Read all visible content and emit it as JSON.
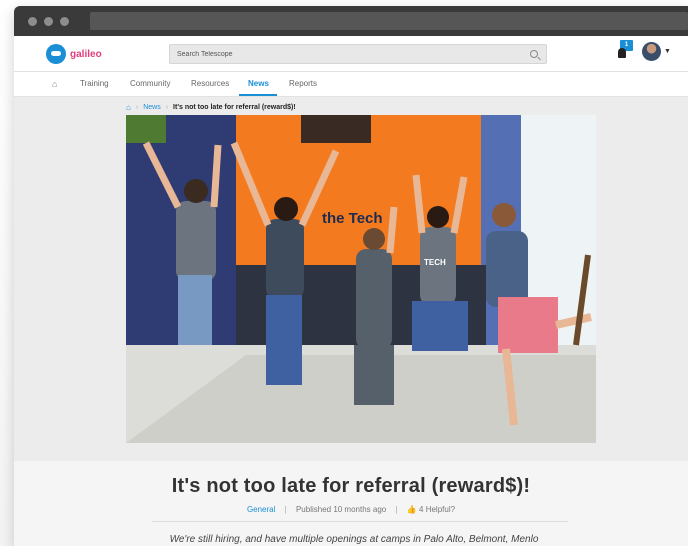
{
  "search": {
    "placeholder": "Search Telescope"
  },
  "logo": {
    "text": "galileo"
  },
  "notifications": {
    "count": "1"
  },
  "nav": {
    "items": [
      {
        "label": "Training"
      },
      {
        "label": "Community"
      },
      {
        "label": "Resources"
      },
      {
        "label": "News"
      },
      {
        "label": "Reports"
      }
    ],
    "active": "News"
  },
  "breadcrumb": {
    "section": "News",
    "current": "It's not too late for referral (reward$)!"
  },
  "post": {
    "title": "It's not too late for referral (reward$)!",
    "category": "General",
    "published": "Published 10 months ago",
    "helpful_count": "4",
    "helpful_label": "Helpful?",
    "body": "We're still hiring, and have multiple openings at camps in Palo Alto, Belmont, Menlo"
  },
  "hero": {
    "sign_text": "the Tech",
    "shirt_text": "TECH"
  },
  "colors": {
    "accent": "#1b8fd6",
    "logo_pink": "#e23c7d",
    "wall_orange": "#f47a1f"
  }
}
